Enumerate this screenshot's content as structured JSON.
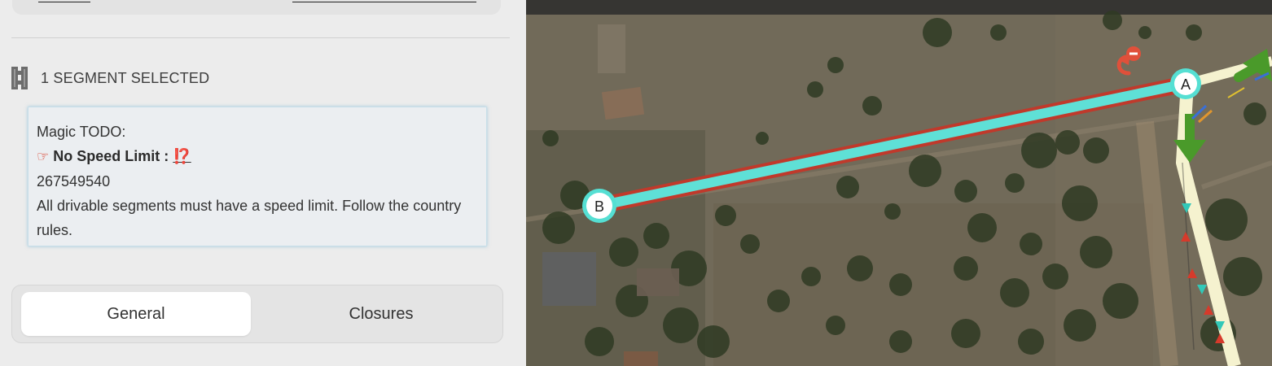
{
  "selection": {
    "title": "1 SEGMENT SELECTED"
  },
  "todo": {
    "heading": "Magic TODO:",
    "pointer": "☞",
    "rule_name": "No Speed Limit :",
    "rule_flag": "⁉️",
    "segment_id": "267549540",
    "message": "All drivable segments must have a speed limit. Follow the country rules."
  },
  "tabs": [
    {
      "label": "General",
      "active": true
    },
    {
      "label": "Closures",
      "active": false
    }
  ],
  "map": {
    "node_a_label": "A",
    "node_b_label": "B",
    "colors": {
      "segment": "#5fe0d6",
      "segment_outline": "#c0392b",
      "node_ring": "#55dfd3",
      "turn_arrow": "#4a9a2a",
      "sat_base": "#6b6353"
    }
  }
}
